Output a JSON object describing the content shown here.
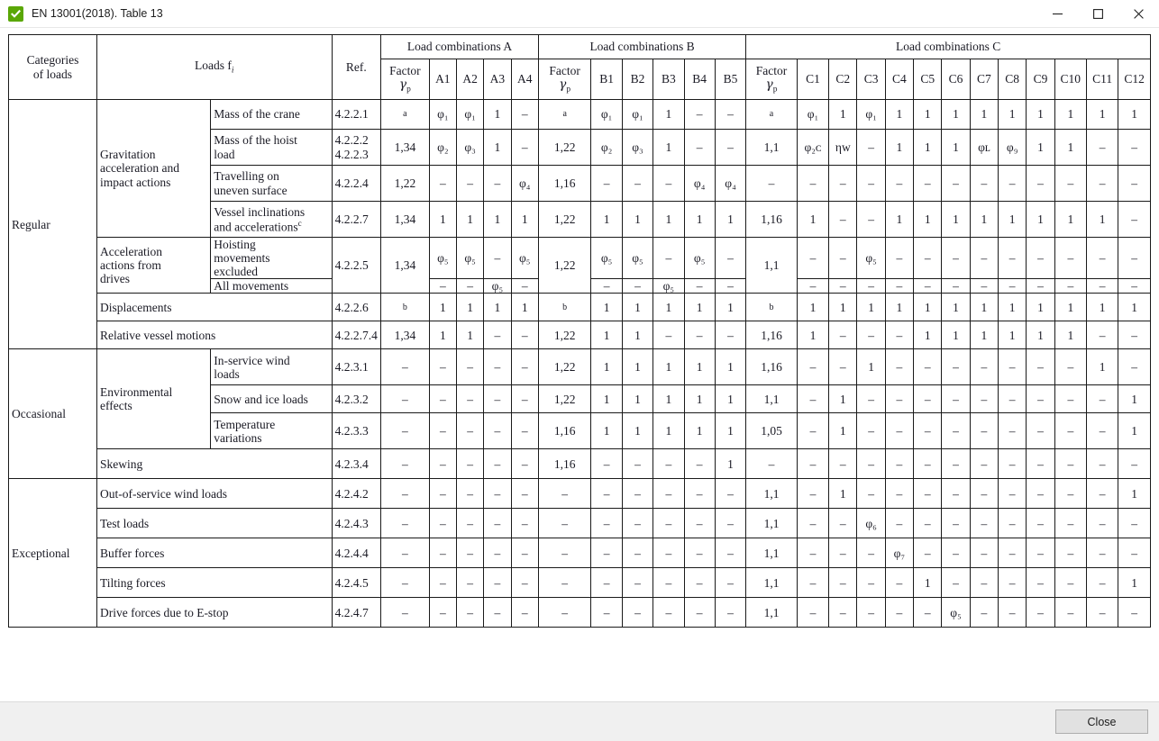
{
  "window": {
    "title": "EN 13001(2018). Table 13",
    "icon": "check-icon",
    "minimize_label": "─",
    "maximize_label": "□",
    "close_label": "✕"
  },
  "footer": {
    "close_label": "Close"
  },
  "table": {
    "headers": {
      "categories": "Categories\nof loads",
      "loads": "Loads f",
      "loads_sub": "i",
      "ref": "Ref.",
      "group_a": "Load combinations A",
      "group_b": "Load combinations B",
      "group_c": "Load combinations C",
      "factor": "Factor",
      "factor_sym": "γ",
      "factor_sub": "p",
      "a_cols": [
        "A1",
        "A2",
        "A3",
        "A4"
      ],
      "b_cols": [
        "B1",
        "B2",
        "B3",
        "B4",
        "B5"
      ],
      "c_cols": [
        "C1",
        "C2",
        "C3",
        "C4",
        "C5",
        "C6",
        "C7",
        "C8",
        "C9",
        "C10",
        "C11",
        "C12"
      ]
    },
    "categories": [
      "Regular",
      "Occasional",
      "Exceptional"
    ],
    "groups": {
      "gravitation": "Gravitation\nacceleration and\nimpact actions",
      "drives": "Acceleration\nactions from\ndrives",
      "environmental": "Environmental\neffects"
    },
    "rows": [
      {
        "label": "Mass of the crane",
        "ref": "4.2.2.1",
        "a_factor": "a",
        "a_factor_small": true,
        "a": [
          "φ₁",
          "φ₁",
          "1",
          "–"
        ],
        "b_factor": "a",
        "b_factor_small": true,
        "b": [
          "φ₁",
          "φ₁",
          "1",
          "–",
          "–"
        ],
        "c_factor": "a",
        "c_factor_small": true,
        "c": [
          "φ₁",
          "1",
          "φ₁",
          "1",
          "1",
          "1",
          "1",
          "1",
          "1",
          "1",
          "1",
          "1"
        ]
      },
      {
        "label": "Mass of the hoist\nload",
        "ref": "4.2.2.2\n4.2.2.3",
        "a_factor": "1,34",
        "a": [
          "φ₂",
          "φ₃",
          "1",
          "–"
        ],
        "b_factor": "1,22",
        "b": [
          "φ₂",
          "φ₃",
          "1",
          "–",
          "–"
        ],
        "c_factor": "1,1",
        "c": [
          "φ₂ᴄ",
          "ηᴡ",
          "–",
          "1",
          "1",
          "1",
          "φʟ",
          "φ₉",
          "1",
          "1",
          "–",
          "–"
        ]
      },
      {
        "label": "Travelling on\nuneven surface",
        "ref": "4.2.2.4",
        "a_factor": "1,22",
        "a": [
          "–",
          "–",
          "–",
          "φ₄"
        ],
        "b_factor": "1,16",
        "b": [
          "–",
          "–",
          "–",
          "φ₄",
          "φ₄"
        ],
        "c_factor": "–",
        "c": [
          "–",
          "–",
          "–",
          "–",
          "–",
          "–",
          "–",
          "–",
          "–",
          "–",
          "–",
          "–"
        ]
      },
      {
        "label": "Vessel inclinations\nand accelerations",
        "label_sup": "c",
        "ref": "4.2.2.7",
        "a_factor": "1,34",
        "a": [
          "1",
          "1",
          "1",
          "1"
        ],
        "b_factor": "1,22",
        "b": [
          "1",
          "1",
          "1",
          "1",
          "1"
        ],
        "c_factor": "1,16",
        "c": [
          "1",
          "–",
          "–",
          "1",
          "1",
          "1",
          "1",
          "1",
          "1",
          "1",
          "1",
          "–"
        ]
      },
      {
        "label": "Hoisting\nmovements\nexcluded",
        "ref": "4.2.2.5",
        "a_factor": "1,34",
        "a": [
          "φ₅",
          "φ₅",
          "–",
          "φ₅"
        ],
        "b_factor": "1,22",
        "b": [
          "φ₅",
          "φ₅",
          "–",
          "φ₅",
          "–"
        ],
        "c_factor": "1,1",
        "c": [
          "–",
          "–",
          "φ₅",
          "–",
          "–",
          "–",
          "–",
          "–",
          "–",
          "–",
          "–",
          "–"
        ]
      },
      {
        "label": "All movements",
        "ref": "",
        "a_factor": "",
        "a": [
          "–",
          "–",
          "φ₅",
          "–"
        ],
        "b_factor": "",
        "b": [
          "–",
          "–",
          "φ₅",
          "–",
          "–"
        ],
        "c_factor": "",
        "c": [
          "–",
          "–",
          "–",
          "–",
          "–",
          "–",
          "–",
          "–",
          "–",
          "–",
          "–",
          "–"
        ]
      },
      {
        "label": "Displacements",
        "ref": "4.2.2.6",
        "a_factor": "b",
        "a_factor_small": true,
        "a": [
          "1",
          "1",
          "1",
          "1"
        ],
        "b_factor": "b",
        "b_factor_small": true,
        "b": [
          "1",
          "1",
          "1",
          "1",
          "1"
        ],
        "c_factor": "b",
        "c_factor_small": true,
        "c": [
          "1",
          "1",
          "1",
          "1",
          "1",
          "1",
          "1",
          "1",
          "1",
          "1",
          "1",
          "1"
        ]
      },
      {
        "label": "Relative vessel motions",
        "ref": "4.2.2.7.4",
        "a_factor": "1,34",
        "a": [
          "1",
          "1",
          "–",
          "–"
        ],
        "b_factor": "1,22",
        "b": [
          "1",
          "1",
          "–",
          "–",
          "–"
        ],
        "c_factor": "1,16",
        "c": [
          "1",
          "–",
          "–",
          "–",
          "1",
          "1",
          "1",
          "1",
          "1",
          "1",
          "–",
          "–"
        ]
      },
      {
        "label": "In-service wind\nloads",
        "ref": "4.2.3.1",
        "a_factor": "–",
        "a": [
          "–",
          "–",
          "–",
          "–"
        ],
        "b_factor": "1,22",
        "b": [
          "1",
          "1",
          "1",
          "1",
          "1"
        ],
        "c_factor": "1,16",
        "c": [
          "–",
          "–",
          "1",
          "–",
          "–",
          "–",
          "–",
          "–",
          "–",
          "–",
          "1",
          "–"
        ]
      },
      {
        "label": "Snow and ice loads",
        "ref": "4.2.3.2",
        "a_factor": "–",
        "a": [
          "–",
          "–",
          "–",
          "–"
        ],
        "b_factor": "1,22",
        "b": [
          "1",
          "1",
          "1",
          "1",
          "1"
        ],
        "c_factor": "1,1",
        "c": [
          "–",
          "1",
          "–",
          "–",
          "–",
          "–",
          "–",
          "–",
          "–",
          "–",
          "–",
          "1"
        ]
      },
      {
        "label": "Temperature\nvariations",
        "ref": "4.2.3.3",
        "a_factor": "–",
        "a": [
          "–",
          "–",
          "–",
          "–"
        ],
        "b_factor": "1,16",
        "b": [
          "1",
          "1",
          "1",
          "1",
          "1"
        ],
        "c_factor": "1,05",
        "c": [
          "–",
          "1",
          "–",
          "–",
          "–",
          "–",
          "–",
          "–",
          "–",
          "–",
          "–",
          "1"
        ]
      },
      {
        "label": "Skewing",
        "ref": "4.2.3.4",
        "a_factor": "–",
        "a": [
          "–",
          "–",
          "–",
          "–"
        ],
        "b_factor": "1,16",
        "b": [
          "–",
          "–",
          "–",
          "–",
          "1"
        ],
        "c_factor": "–",
        "c": [
          "–",
          "–",
          "–",
          "–",
          "–",
          "–",
          "–",
          "–",
          "–",
          "–",
          "–",
          "–"
        ]
      },
      {
        "label": "Out-of-service wind loads",
        "ref": "4.2.4.2",
        "a_factor": "–",
        "a": [
          "–",
          "–",
          "–",
          "–"
        ],
        "b_factor": "–",
        "b": [
          "–",
          "–",
          "–",
          "–",
          "–"
        ],
        "c_factor": "1,1",
        "c": [
          "–",
          "1",
          "–",
          "–",
          "–",
          "–",
          "–",
          "–",
          "–",
          "–",
          "–",
          "1"
        ]
      },
      {
        "label": "Test loads",
        "ref": "4.2.4.3",
        "a_factor": "–",
        "a": [
          "–",
          "–",
          "–",
          "–"
        ],
        "b_factor": "–",
        "b": [
          "–",
          "–",
          "–",
          "–",
          "–"
        ],
        "c_factor": "1,1",
        "c": [
          "–",
          "–",
          "φ₆",
          "–",
          "–",
          "–",
          "–",
          "–",
          "–",
          "–",
          "–",
          "–"
        ]
      },
      {
        "label": "Buffer forces",
        "ref": "4.2.4.4",
        "a_factor": "–",
        "a": [
          "–",
          "–",
          "–",
          "–"
        ],
        "b_factor": "–",
        "b": [
          "–",
          "–",
          "–",
          "–",
          "–"
        ],
        "c_factor": "1,1",
        "c": [
          "–",
          "–",
          "–",
          "φ₇",
          "–",
          "–",
          "–",
          "–",
          "–",
          "–",
          "–",
          "–"
        ]
      },
      {
        "label": "Tilting forces",
        "ref": "4.2.4.5",
        "a_factor": "–",
        "a": [
          "–",
          "–",
          "–",
          "–"
        ],
        "b_factor": "–",
        "b": [
          "–",
          "–",
          "–",
          "–",
          "–"
        ],
        "c_factor": "1,1",
        "c": [
          "–",
          "–",
          "–",
          "–",
          "1",
          "–",
          "–",
          "–",
          "–",
          "–",
          "–",
          "1"
        ]
      },
      {
        "label": "Drive forces due to E-stop",
        "ref": "4.2.4.7",
        "a_factor": "–",
        "a": [
          "–",
          "–",
          "–",
          "–"
        ],
        "b_factor": "–",
        "b": [
          "–",
          "–",
          "–",
          "–",
          "–"
        ],
        "c_factor": "1,1",
        "c": [
          "–",
          "–",
          "–",
          "–",
          "–",
          "φ₅",
          "–",
          "–",
          "–",
          "–",
          "–",
          "–"
        ]
      }
    ]
  }
}
